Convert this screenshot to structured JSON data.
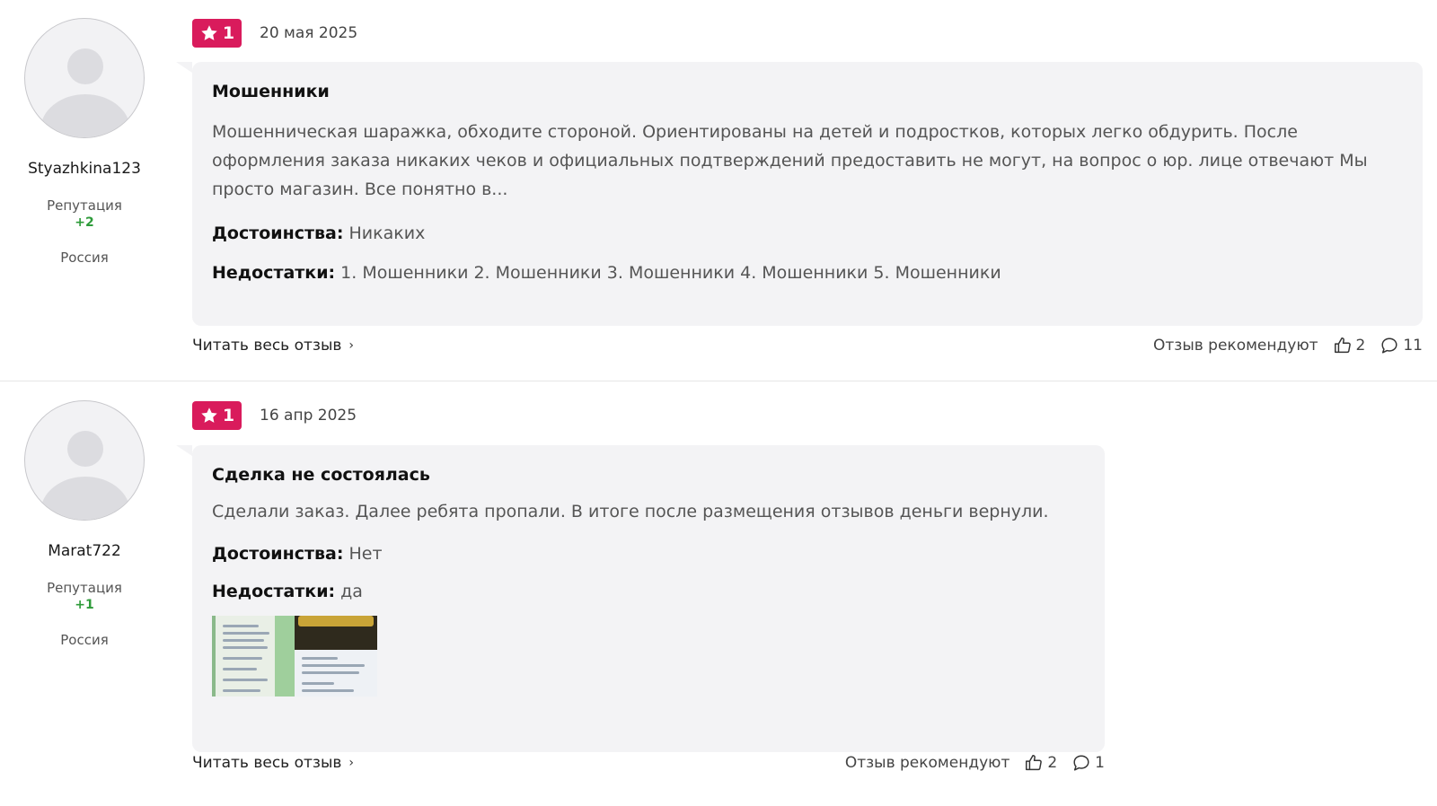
{
  "reviews": [
    {
      "author": {
        "name": "Styazhkina123",
        "reputation_label": "Репутация",
        "reputation": "+2",
        "country": "Россия"
      },
      "rating": "1",
      "date": "20 мая 2025",
      "title": "Мошенники",
      "text": "Мошенническая шаражка, обходите стороной. Ориентированы на детей и подростков, которых легко обдурить. После оформления заказа никаких чеков и официальных подтверждений предоставить не могут, на вопрос о юр. лице отвечают Мы просто магазин. Все понятно в...",
      "pros_label": "Достоинства:",
      "pros": "Никаких",
      "cons_label": "Недостатки:",
      "cons": "1. Мошенники 2. Мошенники 3. Мошенники 4. Мошенники 5. Мошенники",
      "read_more": "Читать весь отзыв",
      "recommend_label": "Отзыв рекомендуют",
      "likes": "2",
      "comments": "11"
    },
    {
      "author": {
        "name": "Marat722",
        "reputation_label": "Репутация",
        "reputation": "+1",
        "country": "Россия"
      },
      "rating": "1",
      "date": "16 апр 2025",
      "title": "Сделка не состоялась",
      "text": "Сделали заказ. Далее ребята пропали. В итоге после размещения отзывов деньги вернули.",
      "pros_label": "Достоинства:",
      "pros": "Нет",
      "cons_label": "Недостатки:",
      "cons": "да",
      "read_more": "Читать весь отзыв",
      "recommend_label": "Отзыв рекомендуют",
      "likes": "2",
      "comments": "1"
    }
  ],
  "colors": {
    "badge": "#d91b5c",
    "reputation": "#2e9b3a",
    "card_bg": "#f3f3f5"
  },
  "icons": {
    "rating": "star-icon",
    "like": "thumbs-up-icon",
    "comment": "comment-icon",
    "read_more": "chevron-right-icon"
  }
}
